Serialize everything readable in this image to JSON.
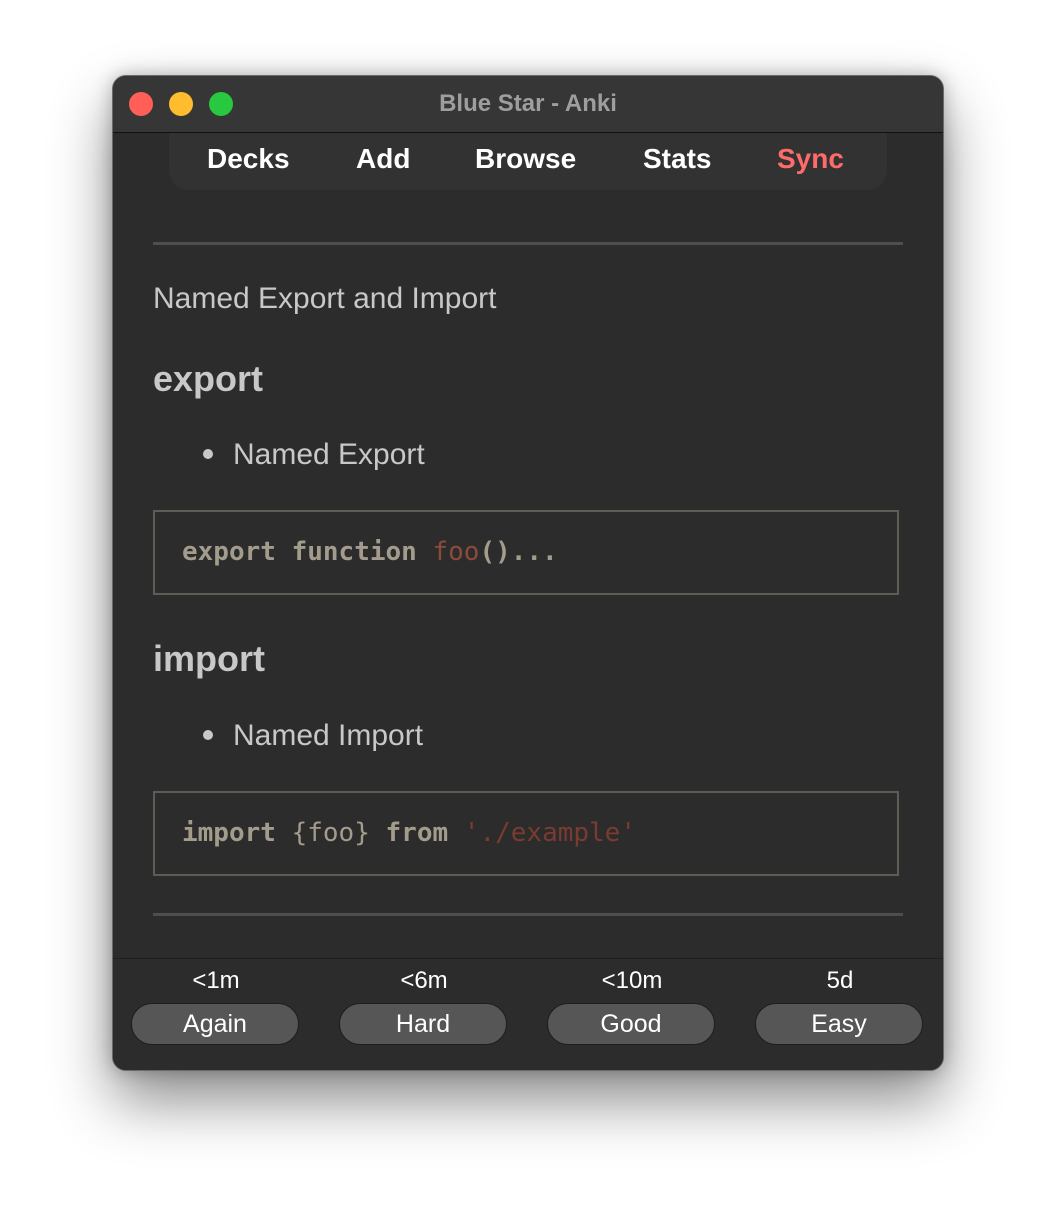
{
  "window": {
    "title": "Blue Star - Anki"
  },
  "toolbar": {
    "items": [
      {
        "label": "Decks"
      },
      {
        "label": "Add"
      },
      {
        "label": "Browse"
      },
      {
        "label": "Stats"
      },
      {
        "label": "Sync",
        "color": "#ff6b6b"
      }
    ]
  },
  "card": {
    "title": "Named Export and Import",
    "sections": [
      {
        "heading": "export",
        "bullet": "Named Export",
        "code": {
          "keyword1": "export",
          "keyword2": "function",
          "name": "foo",
          "rest": "()..."
        }
      },
      {
        "heading": "import",
        "bullet": "Named Import",
        "code": {
          "keyword1": "import",
          "braces": "{foo}",
          "keyword2": "from",
          "string": "'./example'"
        }
      }
    ]
  },
  "answer_buttons": [
    {
      "time": "<1m",
      "label": "Again"
    },
    {
      "time": "<6m",
      "label": "Hard"
    },
    {
      "time": "<10m",
      "label": "Good"
    },
    {
      "time": "5d",
      "label": "Easy"
    }
  ],
  "colors": {
    "window_bg": "#2c2c2c",
    "sync_accent": "#ff6b6b",
    "code_function_name": "#8c4a3c",
    "code_string": "#7a3b30"
  }
}
